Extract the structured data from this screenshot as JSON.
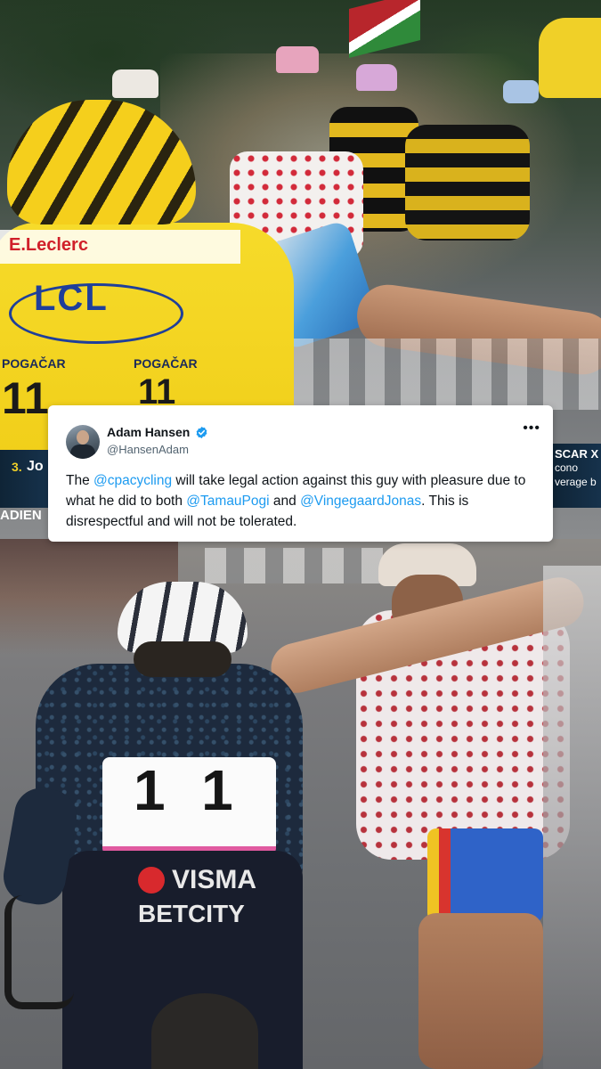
{
  "tweet": {
    "display_name": "Adam Hansen",
    "handle": "@HansenAdam",
    "more_icon": "more-horizontal-icon",
    "verified_icon": "verified-badge-icon",
    "text": {
      "part1": "The ",
      "mention1": "@cpacycling",
      "part2": " will take legal action against this guy with pleasure due to what he did to both ",
      "mention2": "@TamauPogi",
      "part3": " and ",
      "mention3": "@VingegaardJonas",
      "part4": ". This is disrespectful and will not be tolerated."
    }
  },
  "video": {
    "top_jersey": {
      "sponsor": "LCL",
      "brand": "E.Leclerc",
      "name_left": "POGAČAR",
      "name_right": "POGAČAR",
      "number": "11"
    },
    "overlay_left": {
      "rank": "3.",
      "name": "Jo",
      "sub": "ADIEN"
    },
    "overlay_right": {
      "line1": "SCAR X",
      "line2": "cono",
      "line3": "verage b"
    },
    "bottom_jersey": {
      "number": "11",
      "brand1": "VISMA",
      "brand2": "BETCITY"
    }
  },
  "colors": {
    "accent": "#1d9bf0",
    "yellow_jersey": "#f2d21b",
    "card_bg": "#ffffff"
  }
}
